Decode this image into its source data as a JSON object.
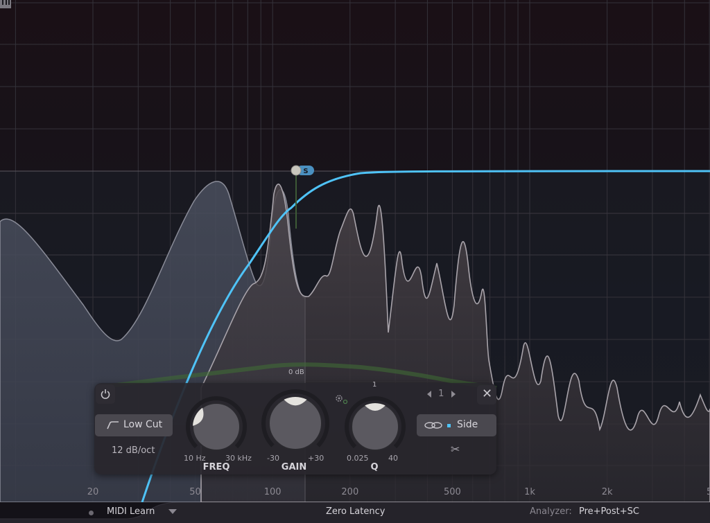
{
  "analyzer_display": {
    "freq_labels": [
      {
        "label": "20",
        "hz": 20
      },
      {
        "label": "50",
        "hz": 50
      },
      {
        "label": "100",
        "hz": 100
      },
      {
        "label": "200",
        "hz": 200
      },
      {
        "label": "500",
        "hz": 500
      },
      {
        "label": "1k",
        "hz": 1000
      },
      {
        "label": "2k",
        "hz": 2000
      },
      {
        "label": "5",
        "hz": 5000
      }
    ],
    "eq_curve_color": "#4fc3f7",
    "band_node": {
      "badge": "S",
      "badge_color": "#4a90c0"
    }
  },
  "band_panel": {
    "power_icon": "power-icon",
    "filter_shape": "Low Cut",
    "slope": "12 dB/oct",
    "freq": {
      "label": "FREQ",
      "min": "10 Hz",
      "max": "30 kHz",
      "value_fraction": 0.27
    },
    "gain": {
      "label": "GAIN",
      "min": "-30",
      "max": "+30",
      "center": "0 dB",
      "value_fraction": 0.5
    },
    "q": {
      "label": "Q",
      "min": "0.025",
      "max": "40",
      "center": "1",
      "value_fraction": 0.5
    },
    "band_number": "1",
    "stereo_mode": "Side",
    "stereo_dot_color": "#4fc3f7"
  },
  "statusbar": {
    "midi_learn": "MIDI Learn",
    "latency": "Zero Latency",
    "analyzer_label": "Analyzer:",
    "analyzer_value": "Pre+Post+SC"
  }
}
